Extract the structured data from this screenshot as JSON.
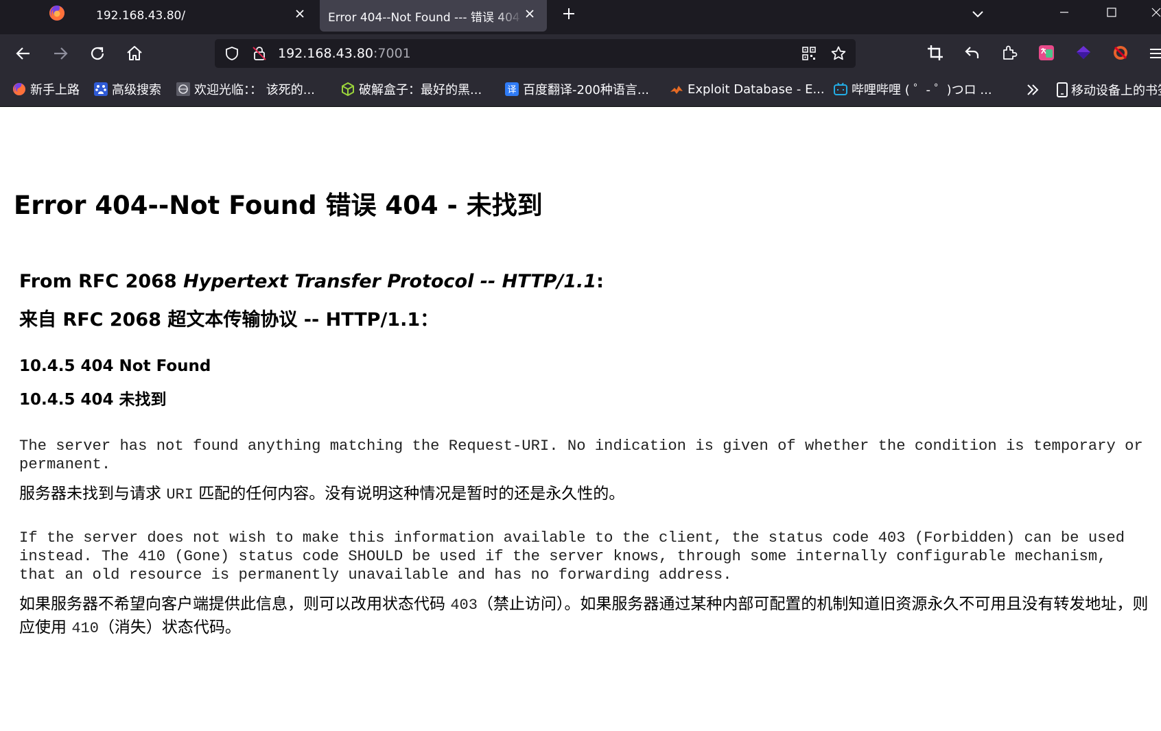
{
  "browser": {
    "tabs": [
      {
        "label": "192.168.43.80/"
      },
      {
        "label": "Error 404--Not Found --- 错误 404"
      }
    ],
    "url_host": "192.168.43.80",
    "url_port": ":7001",
    "bookmarks": [
      {
        "label": "新手上路",
        "icon": "firefox-icon"
      },
      {
        "label": "高级搜索",
        "icon": "baidu-icon"
      },
      {
        "label": "欢迎光临：： 该死的...",
        "icon": "globe-icon"
      },
      {
        "label": "破解盒子：最好的黑...",
        "icon": "cube-icon"
      },
      {
        "label": "百度翻译-200种语言...",
        "icon": "translate-icon"
      },
      {
        "label": "Exploit Database - E...",
        "icon": "exploit-db-icon"
      },
      {
        "label": "哔哩哔哩 ( ゜- ゜)つロ ...",
        "icon": "bilibili-icon"
      }
    ],
    "mobile_bookmarks": "移动设备上的书签",
    "colors": {
      "tab_strip": "#1c1b22",
      "toolbar": "#2b2a33",
      "active_tab": "#42414d"
    }
  },
  "page": {
    "title": "Error 404--Not Found 错误 404 - 未找到",
    "rfc_en_prefix": "From RFC 2068 ",
    "rfc_en_italic": "Hypertext Transfer Protocol -- HTTP/1.1",
    "rfc_en_suffix": ":",
    "rfc_cn": "来自 RFC 2068 超文本传输协议 -- HTTP/1.1：",
    "heading_en": "10.4.5 404 Not Found",
    "heading_cn": "10.4.5 404 未找到",
    "para1_en": "The server has not found anything matching the Request-URI. No indication is given of whether the condition is temporary or permanent.",
    "para1_cn_a": "服务器未找到与请求 ",
    "para1_cn_code": "URI",
    "para1_cn_b": " 匹配的任何内容。没有说明这种情况是暂时的还是永久性的。",
    "para2_en": "If the server does not wish to make this information available to the client, the status code 403 (Forbidden) can be used instead. The 410 (Gone) status code SHOULD be used if the server knows, through some internally configurable mechanism, that an old resource is permanently unavailable and has no forwarding address.",
    "para2_cn_a": "如果服务器不希望向客户端提供此信息，则可以改用状态代码 ",
    "para2_cn_code1": "403",
    "para2_cn_b": "（禁止访问）。如果服务器通过某种内部可配置的机制知道旧资源永久不可用且没有转发地址，则应使用 ",
    "para2_cn_code2": "410",
    "para2_cn_c": "（消失）状态代码。"
  }
}
